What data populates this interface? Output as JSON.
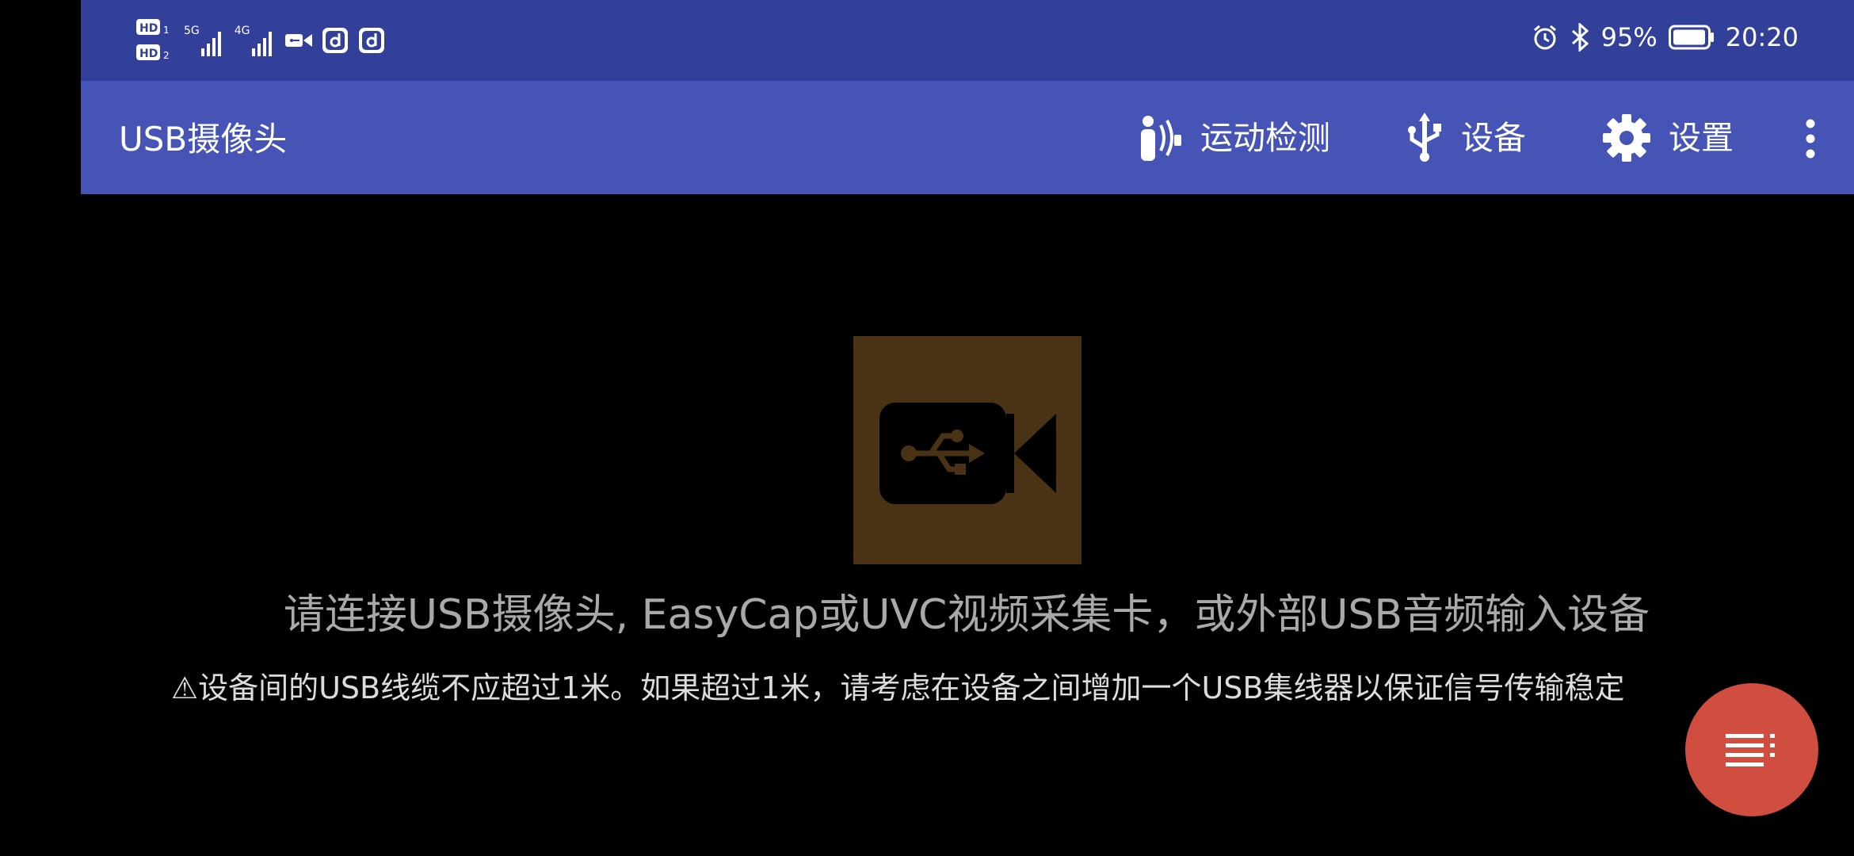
{
  "status_bar": {
    "battery_percent": "95%",
    "time": "20:20",
    "network_1": "5G",
    "network_2": "4G"
  },
  "app_bar": {
    "title": "USB摄像头",
    "actions": {
      "motion_detection": "运动检测",
      "devices": "设备",
      "settings": "设置"
    }
  },
  "main": {
    "prompt": "请连接USB摄像头, EasyCap或UVC视频采集卡，或外部USB音频输入设备",
    "warning_symbol": "⚠",
    "warning": "设备间的USB线缆不应超过1米。如果超过1米，请考虑在设备之间增加一个USB集线器以保证信号传输稳定"
  },
  "colors": {
    "status_bar": "#33409a",
    "app_bar": "#4654b5",
    "fab": "#cf4e3f",
    "hero_bg": "#4a3214"
  }
}
